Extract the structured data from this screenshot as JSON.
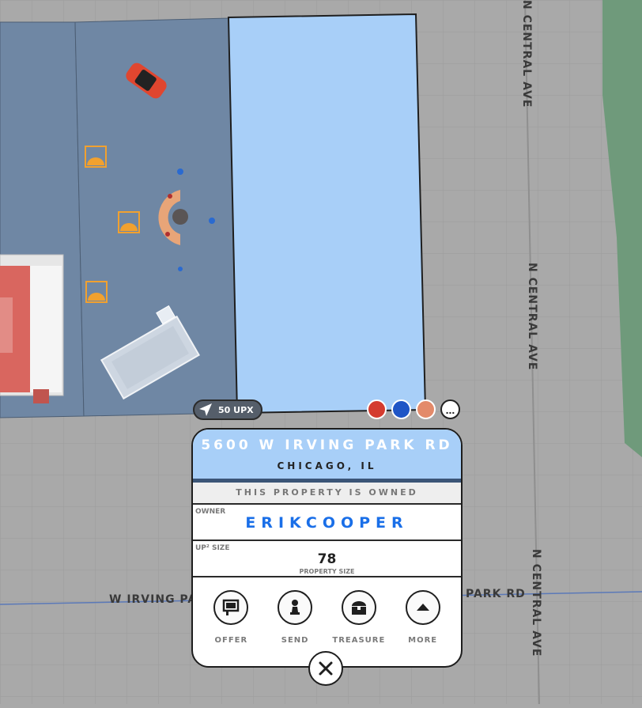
{
  "map": {
    "streets": {
      "central_top": "N CENTRAL AVE",
      "central_mid": "N CENTRAL AVE",
      "central_bottom": "N CENTRAL AVE",
      "irving_left": "W IRVING PA",
      "irving_right": "PARK RD"
    },
    "colors": {
      "ground": "#a9a9a9",
      "owned_parcel": "#6f87a4",
      "selected_parcel": "#a8cff8",
      "park": "#6f9a7b"
    }
  },
  "toolbar": {
    "upx_label": "50 UPX",
    "more_label": "..."
  },
  "property": {
    "address": "5600 W IRVING PARK RD",
    "city": "CHICAGO, IL",
    "status": "THIS PROPERTY IS OWNED",
    "owner_label": "OWNER",
    "owner_name": "ERIKCOOPER",
    "size_label": "UP² SIZE",
    "size_value": "78",
    "size_caption": "PROPERTY SIZE"
  },
  "actions": [
    {
      "label": "OFFER",
      "icon": "billboard-icon"
    },
    {
      "label": "SEND",
      "icon": "pawn-icon"
    },
    {
      "label": "TREASURE",
      "icon": "treasure-chest-icon"
    },
    {
      "label": "MORE",
      "icon": "triangle-up-icon"
    }
  ],
  "close_icon": "close-icon"
}
